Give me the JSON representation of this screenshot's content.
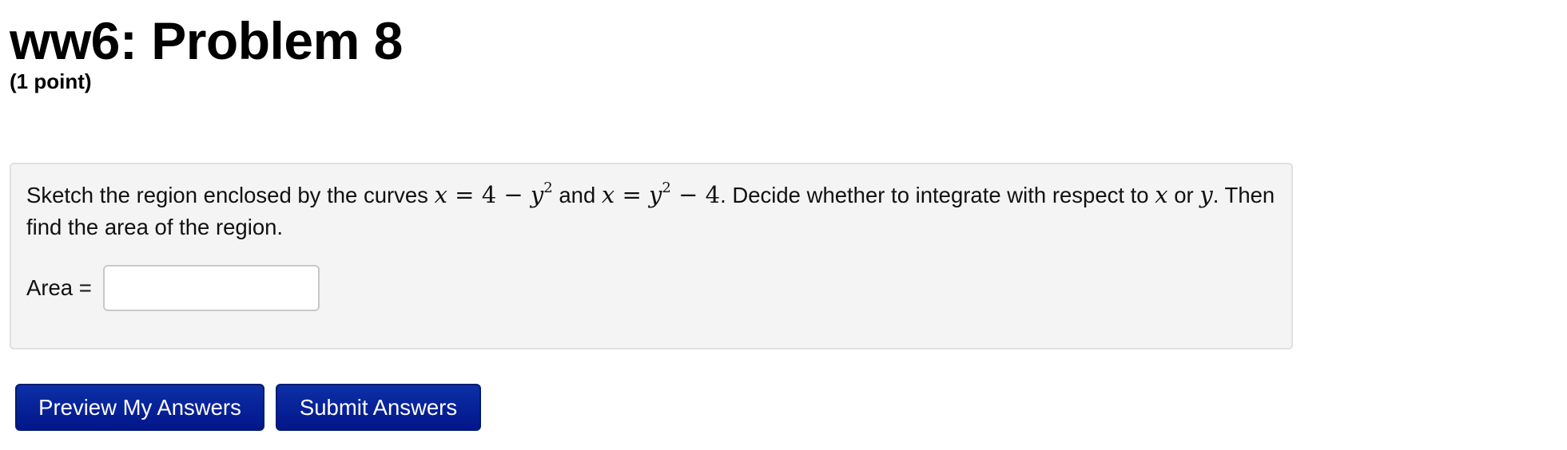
{
  "header": {
    "title": "ww6: Problem 8",
    "points": "(1 point)"
  },
  "problem": {
    "text_1": "Sketch the region enclosed by the curves ",
    "curve_1": {
      "lhs": "x",
      "eq": " = ",
      "const": "4",
      "minus": " − ",
      "var": "y",
      "exp": "2"
    },
    "text_2": " and ",
    "curve_2": {
      "lhs": "x",
      "eq": " = ",
      "var": "y",
      "exp": "2",
      "minus": " − ",
      "const": "4"
    },
    "text_3": ". Decide whether to integrate with respect to ",
    "var_x": "x",
    "text_4": " or ",
    "var_y": "y",
    "text_5": ". Then find the area of the region.",
    "answer_label": "Area =",
    "answer_value": ""
  },
  "buttons": {
    "preview_label": "Preview My Answers",
    "submit_label": "Submit Answers"
  }
}
